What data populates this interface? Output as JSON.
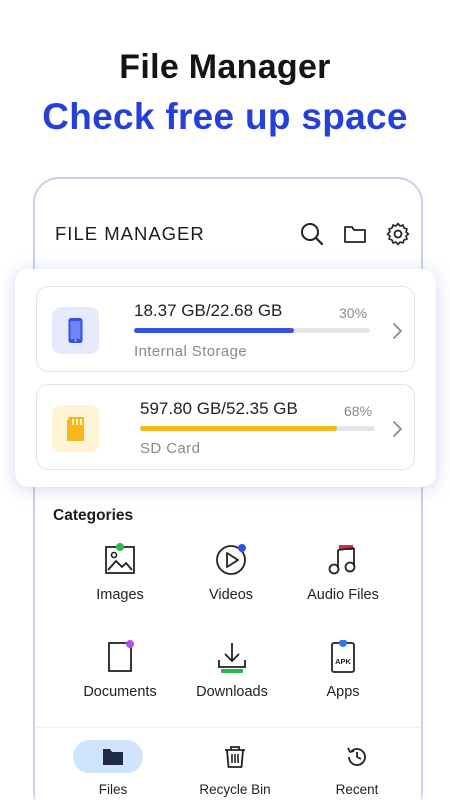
{
  "promo": {
    "title": "File Manager",
    "subtitle": "Check free up space"
  },
  "app": {
    "header_title": "FILE MANAGER",
    "header_icons": [
      "search-icon",
      "folder-icon",
      "gear-icon"
    ]
  },
  "storage": [
    {
      "usage": "18.37 GB/22.68 GB",
      "percent": "30%",
      "fill_fraction": 0.68,
      "name": "Internal Storage",
      "icon": "phone-icon",
      "color": "#3452e6"
    },
    {
      "usage": "597.80 GB/52.35 GB",
      "percent": "68%",
      "fill_fraction": 0.84,
      "name": "SD Card",
      "icon": "sd-card-icon",
      "color": "#f5b81c"
    }
  ],
  "categories": {
    "title": "Categories",
    "items": [
      {
        "label": "Images",
        "icon": "image-icon"
      },
      {
        "label": "Videos",
        "icon": "video-icon"
      },
      {
        "label": "Audio Files",
        "icon": "music-icon"
      },
      {
        "label": "Documents",
        "icon": "document-icon"
      },
      {
        "label": "Downloads",
        "icon": "download-icon"
      },
      {
        "label": "Apps",
        "icon": "apk-icon"
      }
    ]
  },
  "bottom_nav": {
    "items": [
      {
        "label": "Files",
        "icon": "folder-icon",
        "active": true
      },
      {
        "label": "Recycle Bin",
        "icon": "trash-icon",
        "active": false
      },
      {
        "label": "Recent",
        "icon": "history-icon",
        "active": false
      }
    ]
  }
}
